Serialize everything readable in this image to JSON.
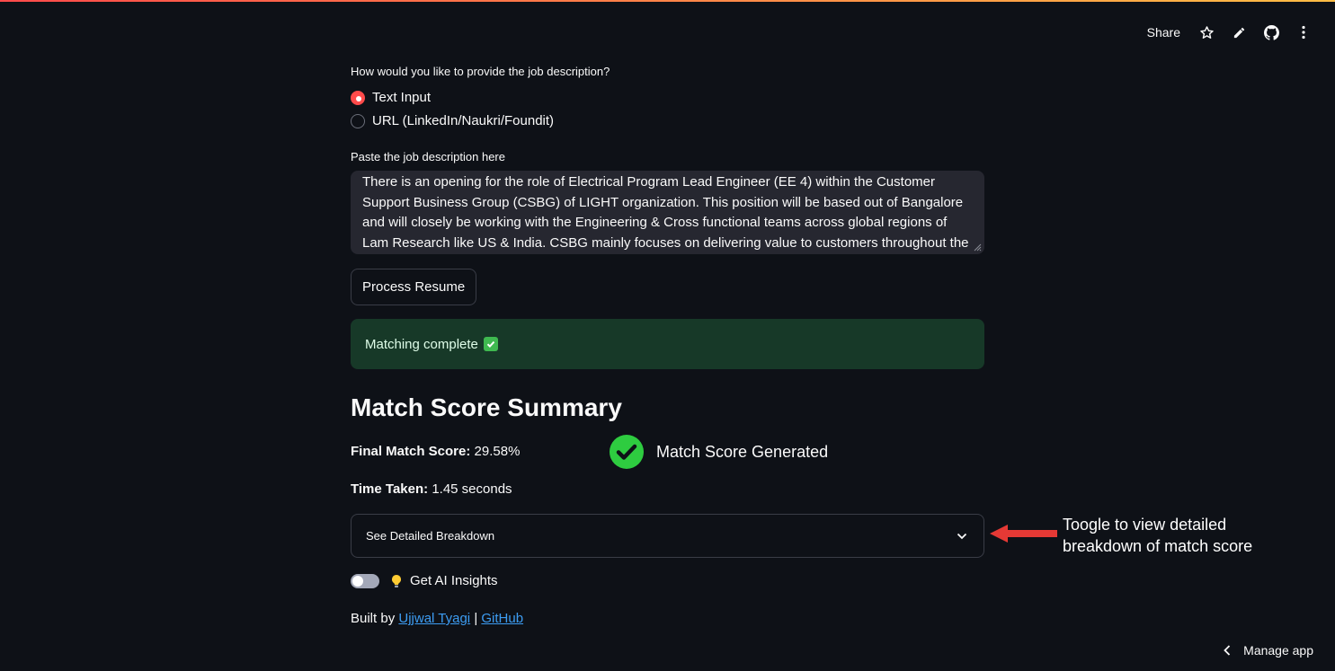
{
  "toolbar": {
    "share_label": "Share",
    "icons": [
      "star-icon",
      "pencil-icon",
      "github-icon",
      "kebab-menu-icon"
    ]
  },
  "form": {
    "question_label": "How would you like to provide the job description?",
    "options": [
      {
        "label": "Text Input",
        "selected": true
      },
      {
        "label": "URL (LinkedIn/Naukri/Foundit)",
        "selected": false
      }
    ],
    "paste_label": "Paste the job description here",
    "job_description": "There is an opening for the role of Electrical Program Lead Engineer (EE 4) within the Customer Support Business Group (CSBG) of LIGHT organization. This position will be based out of Bangalore and will closely be working with the Engineering & Cross functional teams across global regions of Lam Research like US & India. CSBG mainly focuses on delivering value to customers throughout the",
    "process_button": "Process Resume"
  },
  "status": {
    "message": "Matching complete"
  },
  "summary": {
    "heading": "Match Score Summary",
    "final_label": "Final Match Score:",
    "final_value": "29.58%",
    "time_label": "Time Taken:",
    "time_value": "1.45 seconds",
    "generated_text": "Match Score Generated",
    "expander_label": "See Detailed Breakdown",
    "insights_label": "Get AI Insights",
    "insights_enabled": false
  },
  "footer": {
    "built_by": "Built by",
    "author_link": "Ujjwal Tyagi",
    "separator": "|",
    "github_link": "GitHub"
  },
  "annotation": {
    "text": "Toogle to view detailed breakdown of match score"
  },
  "manage_app": "Manage app",
  "colors": {
    "accent": "#ff4b4b",
    "success_bg": "#173928",
    "link": "#3d9df3",
    "annotation_arrow": "#e53935",
    "check_green": "#2ecc40"
  }
}
